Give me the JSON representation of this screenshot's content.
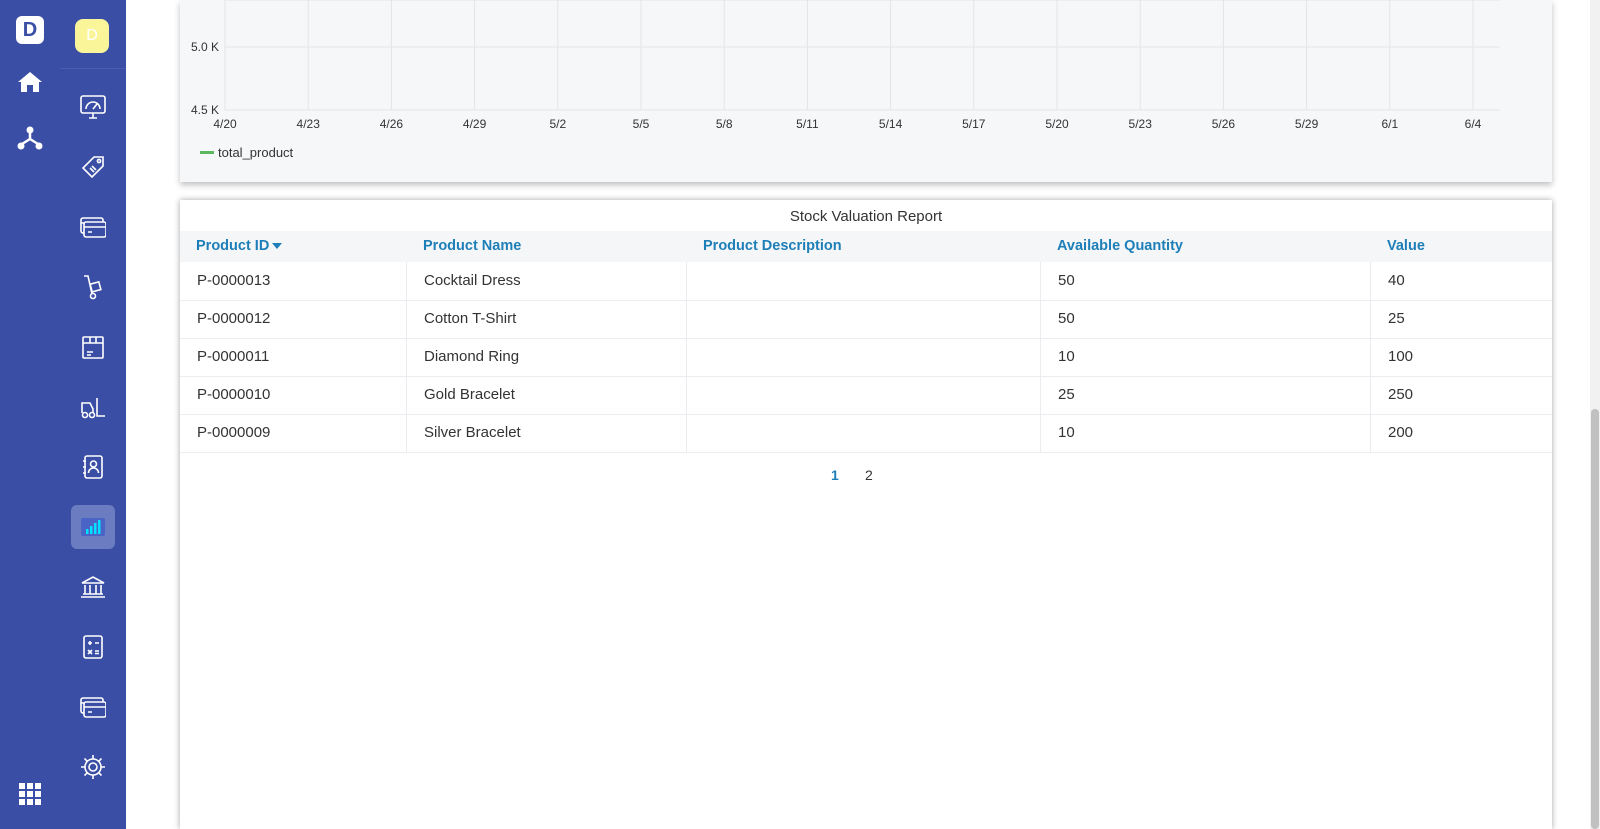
{
  "rail": {
    "logo": "D",
    "icons": [
      "home-icon",
      "hierarchy-icon",
      "apps-grid-icon"
    ]
  },
  "sidebar": {
    "avatar": "D",
    "items": [
      {
        "icon": "dashboard-gauge-icon",
        "active": false
      },
      {
        "icon": "price-tag-icon",
        "active": false
      },
      {
        "icon": "card-icon",
        "active": false
      },
      {
        "icon": "hand-truck-icon",
        "active": false
      },
      {
        "icon": "box-icon",
        "active": false
      },
      {
        "icon": "forklift-icon",
        "active": false
      },
      {
        "icon": "contacts-book-icon",
        "active": false
      },
      {
        "icon": "reports-chart-icon",
        "active": true
      },
      {
        "icon": "bank-icon",
        "active": false
      },
      {
        "icon": "calculator-doc-icon",
        "active": false
      },
      {
        "icon": "cards-icon",
        "active": false
      },
      {
        "icon": "gear-icon",
        "active": false
      }
    ]
  },
  "colors": {
    "sidebar": "#3a4ea5",
    "accent": "#1e7fb8",
    "series": "#5cb85c"
  },
  "chart_data": {
    "type": "line",
    "y_ticks": [
      "5.0 K",
      "4.5 K"
    ],
    "x_ticks": [
      "4/20",
      "4/23",
      "4/26",
      "4/29",
      "5/2",
      "5/5",
      "5/8",
      "5/11",
      "5/14",
      "5/17",
      "5/20",
      "5/23",
      "5/26",
      "5/29",
      "6/1",
      "6/4"
    ],
    "series": [
      {
        "name": "total_product",
        "values": []
      }
    ],
    "grid": true,
    "legend": "bottom-left"
  },
  "report": {
    "title": "Stock Valuation Report",
    "columns": [
      "Product ID",
      "Product Name",
      "Product Description",
      "Available Quantity",
      "Value"
    ],
    "sort_column": "Product ID",
    "rows": [
      {
        "id": "P-0000013",
        "name": "Cocktail Dress",
        "desc": "",
        "qty": "50",
        "value": "40"
      },
      {
        "id": "P-0000012",
        "name": "Cotton T-Shirt",
        "desc": "",
        "qty": "50",
        "value": "25"
      },
      {
        "id": "P-0000011",
        "name": "Diamond Ring",
        "desc": "",
        "qty": "10",
        "value": "100"
      },
      {
        "id": "P-0000010",
        "name": "Gold Bracelet",
        "desc": "",
        "qty": "25",
        "value": "250"
      },
      {
        "id": "P-0000009",
        "name": "Silver Bracelet",
        "desc": "",
        "qty": "10",
        "value": "200"
      }
    ],
    "pages": [
      "1",
      "2"
    ],
    "current_page": "1"
  }
}
